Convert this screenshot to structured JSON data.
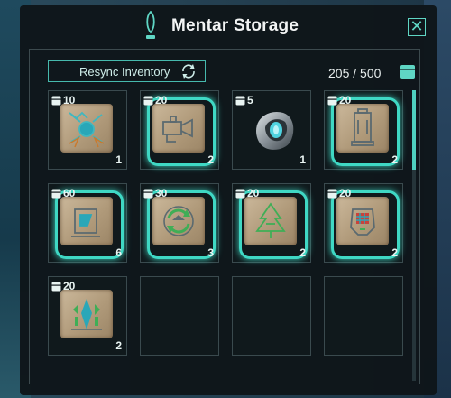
{
  "window": {
    "title": "Mentar Storage",
    "close_label": "✕"
  },
  "toolbar": {
    "resync_label": "Resync Inventory"
  },
  "capacity": {
    "used": "205",
    "separator": "/",
    "max": "500"
  },
  "colors": {
    "accent": "#3fd8c4",
    "panel_bg": "#0e161a",
    "text": "#f2f4f4"
  },
  "slots": [
    {
      "stack": "10",
      "qty": "1",
      "icon": "blueprint-tile-orb",
      "selected": false
    },
    {
      "stack": "20",
      "qty": "2",
      "icon": "blueprint-tile-camera",
      "selected": true
    },
    {
      "stack": "5",
      "qty": "1",
      "icon": "metallic-device",
      "selected": false
    },
    {
      "stack": "20",
      "qty": "2",
      "icon": "blueprint-tile-canister",
      "selected": true
    },
    {
      "stack": "60",
      "qty": "6",
      "icon": "blueprint-tile-press",
      "selected": true
    },
    {
      "stack": "30",
      "qty": "3",
      "icon": "blueprint-tile-recycle",
      "selected": true
    },
    {
      "stack": "20",
      "qty": "2",
      "icon": "blueprint-tile-tree",
      "selected": true
    },
    {
      "stack": "20",
      "qty": "2",
      "icon": "blueprint-tile-gauge",
      "selected": true
    },
    {
      "stack": "20",
      "qty": "2",
      "icon": "blueprint-tile-crystal",
      "selected": false
    }
  ]
}
